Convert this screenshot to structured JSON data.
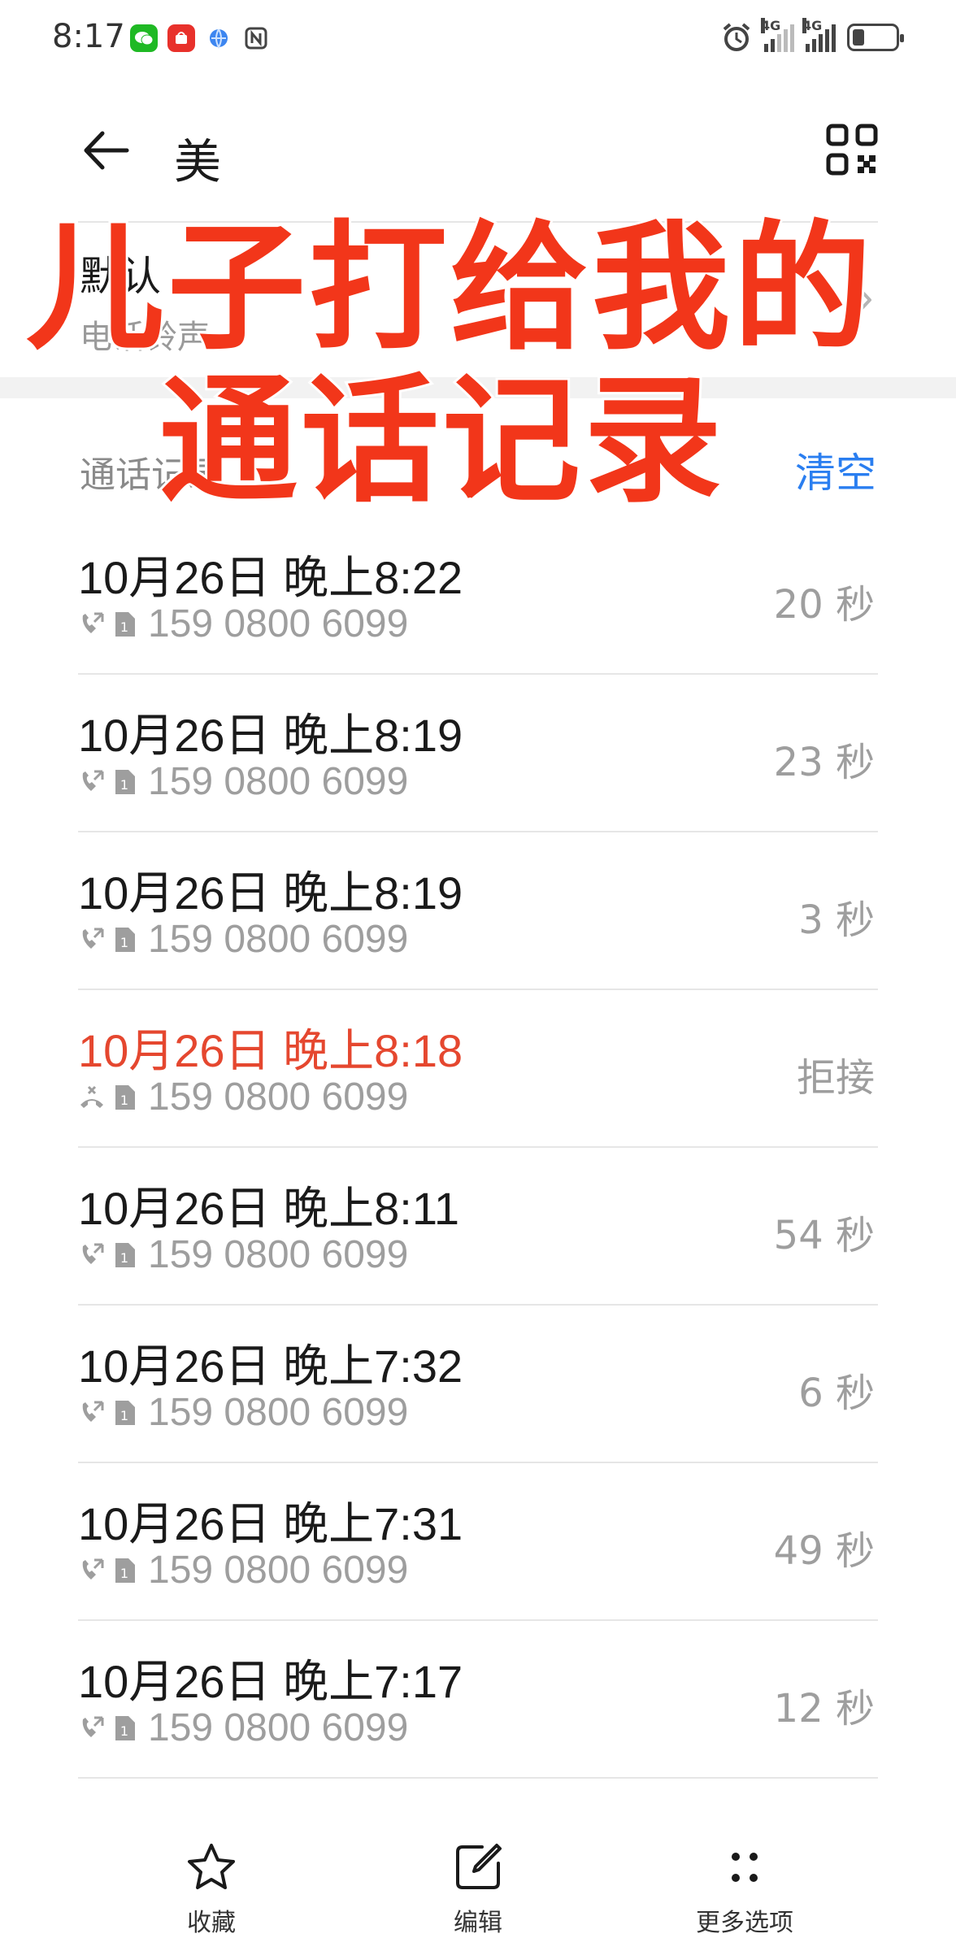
{
  "status_bar": {
    "time": "8:17",
    "network_1": "4G",
    "network_2": "4G"
  },
  "header": {
    "contact_name": "美"
  },
  "ringtone": {
    "title": "默认",
    "subtitle": "电话铃声"
  },
  "call_log": {
    "title": "通话记录",
    "clear_label": "清空",
    "rows": [
      {
        "time": "10月26日 晚上8:22",
        "number": "159 0800 6099",
        "duration": "20 秒",
        "type": "outgoing"
      },
      {
        "time": "10月26日 晚上8:19",
        "number": "159 0800 6099",
        "duration": "23 秒",
        "type": "outgoing"
      },
      {
        "time": "10月26日 晚上8:19",
        "number": "159 0800 6099",
        "duration": "3 秒",
        "type": "outgoing"
      },
      {
        "time": "10月26日 晚上8:18",
        "number": "159 0800 6099",
        "duration": "拒接",
        "type": "rejected"
      },
      {
        "time": "10月26日 晚上8:11",
        "number": "159 0800 6099",
        "duration": "54 秒",
        "type": "outgoing"
      },
      {
        "time": "10月26日 晚上7:32",
        "number": "159 0800 6099",
        "duration": "6 秒",
        "type": "outgoing"
      },
      {
        "time": "10月26日 晚上7:31",
        "number": "159 0800 6099",
        "duration": "49 秒",
        "type": "outgoing"
      },
      {
        "time": "10月26日 晚上7:17",
        "number": "159 0800 6099",
        "duration": "12 秒",
        "type": "outgoing"
      }
    ]
  },
  "overlay": {
    "line1": "儿子打给我的",
    "line2": "通话记录"
  },
  "bottom_bar": {
    "favorite_label": "收藏",
    "edit_label": "编辑",
    "more_label": "更多选项"
  },
  "colors": {
    "accent": "#2a7ef0",
    "rejected": "#e5472f",
    "overlay_text": "#f2361a"
  }
}
